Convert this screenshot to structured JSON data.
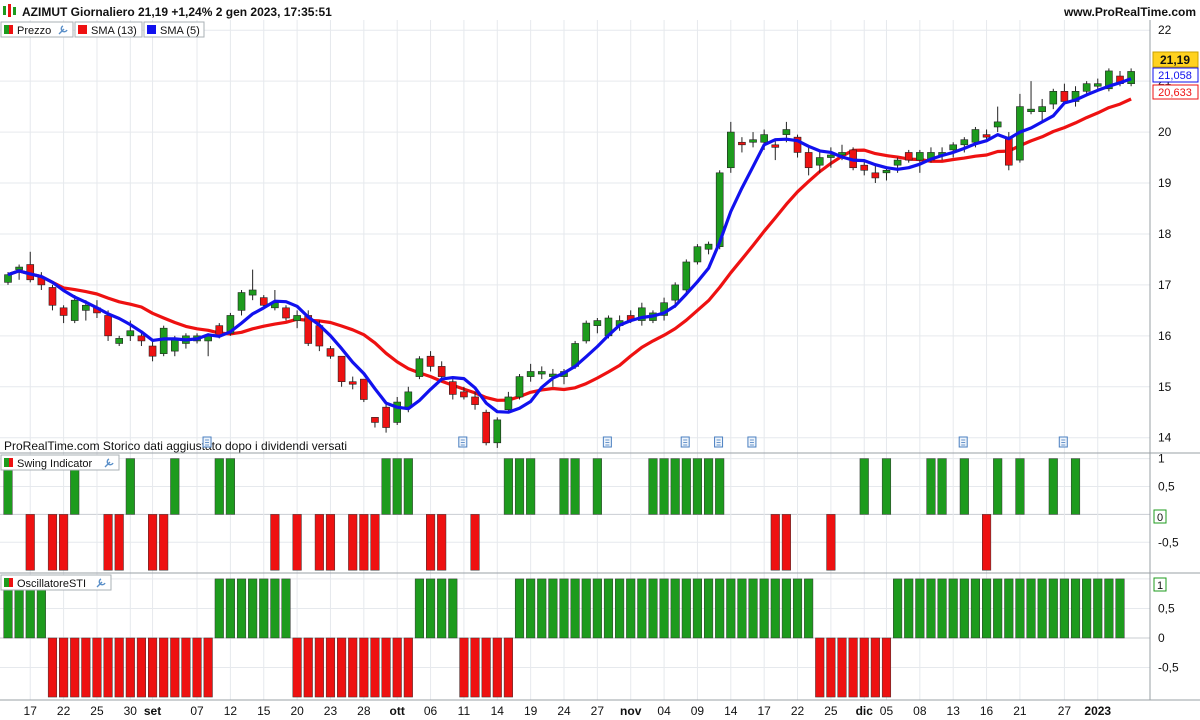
{
  "header": {
    "title": "AZIMUT Giornaliero 21,19 +1,24% 2 gen 2023, 17:35:51",
    "site": "www.ProRealTime.com"
  },
  "legend_main": [
    {
      "label": "Prezzo",
      "color": "#1d9b1d"
    },
    {
      "label": "SMA (13)",
      "color": "#ee1111"
    },
    {
      "label": "SMA (5)",
      "color": "#1111ee"
    }
  ],
  "notice": "ProRealTime.com Storico dati aggiustato dopo i dividendi versati",
  "panel2_title": "Swing Indicator",
  "panel3_title": "OscillatoreSTI",
  "colors": {
    "up": "#1d9b1d",
    "down": "#ee1111",
    "sma13": "#ee1111",
    "sma5": "#1111ee",
    "last_bg": "#ffd21f"
  },
  "chart_data": [
    {
      "type": "candlestick",
      "title": "AZIMUT Giornaliero",
      "ylim": [
        13.7,
        22.2
      ],
      "y_ticks": [
        "14",
        "15",
        "16",
        "17",
        "18",
        "19",
        "20",
        "21",
        "22"
      ],
      "y_tick_values": [
        14,
        15,
        16,
        17,
        18,
        19,
        20,
        21,
        22
      ],
      "x_tick_labels": [
        "17",
        "22",
        "25",
        "30",
        "set",
        "07",
        "12",
        "15",
        "20",
        "23",
        "28",
        "ott",
        "06",
        "11",
        "14",
        "19",
        "24",
        "27",
        "nov",
        "04",
        "09",
        "14",
        "17",
        "22",
        "25",
        "dic",
        "05",
        "08",
        "13",
        "16",
        "21",
        "27",
        "2023"
      ],
      "x_tick_index": [
        2,
        5,
        8,
        11,
        13,
        17,
        20,
        23,
        26,
        29,
        32,
        35,
        38,
        41,
        44,
        47,
        50,
        53,
        56,
        59,
        62,
        65,
        68,
        71,
        74,
        77,
        79,
        82,
        85,
        88,
        91,
        95,
        98
      ],
      "last_values": {
        "price": "21,19",
        "sma5": "21,058",
        "sma13": "20,633"
      },
      "candles": [
        [
          17.05,
          17.25,
          17.0,
          17.2
        ],
        [
          17.3,
          17.4,
          17.1,
          17.35
        ],
        [
          17.4,
          17.65,
          17.05,
          17.1
        ],
        [
          17.15,
          17.25,
          16.9,
          17.0
        ],
        [
          16.95,
          17.0,
          16.5,
          16.6
        ],
        [
          16.55,
          16.6,
          16.25,
          16.4
        ],
        [
          16.3,
          16.8,
          16.25,
          16.7
        ],
        [
          16.5,
          16.7,
          16.3,
          16.6
        ],
        [
          16.55,
          16.7,
          16.35,
          16.45
        ],
        [
          16.4,
          16.5,
          15.9,
          16.0
        ],
        [
          15.85,
          16.0,
          15.8,
          15.95
        ],
        [
          16.0,
          16.3,
          15.9,
          16.1
        ],
        [
          16.0,
          16.1,
          15.8,
          15.9
        ],
        [
          15.8,
          15.9,
          15.5,
          15.6
        ],
        [
          15.65,
          16.2,
          15.6,
          16.15
        ],
        [
          15.7,
          16.0,
          15.6,
          15.95
        ],
        [
          15.85,
          16.05,
          15.75,
          16.0
        ],
        [
          15.9,
          16.05,
          15.85,
          16.0
        ],
        [
          15.9,
          16.05,
          15.6,
          16.0
        ],
        [
          16.2,
          16.25,
          15.95,
          16.0
        ],
        [
          16.05,
          16.45,
          16.0,
          16.4
        ],
        [
          16.5,
          16.9,
          16.4,
          16.85
        ],
        [
          16.8,
          17.3,
          16.7,
          16.9
        ],
        [
          16.75,
          16.8,
          16.55,
          16.6
        ],
        [
          16.55,
          16.9,
          16.5,
          16.65
        ],
        [
          16.55,
          16.6,
          16.3,
          16.35
        ],
        [
          16.3,
          16.5,
          16.15,
          16.4
        ],
        [
          16.4,
          16.5,
          15.8,
          15.85
        ],
        [
          16.2,
          16.3,
          15.7,
          15.8
        ],
        [
          15.75,
          15.8,
          15.55,
          15.6
        ],
        [
          15.6,
          15.6,
          15.0,
          15.1
        ],
        [
          15.1,
          15.2,
          14.95,
          15.05
        ],
        [
          15.15,
          15.15,
          14.7,
          14.75
        ],
        [
          14.4,
          14.4,
          14.2,
          14.3
        ],
        [
          14.6,
          14.65,
          14.1,
          14.2
        ],
        [
          14.3,
          14.8,
          14.25,
          14.7
        ],
        [
          14.6,
          15.0,
          14.5,
          14.9
        ],
        [
          15.2,
          15.6,
          15.15,
          15.55
        ],
        [
          15.6,
          15.7,
          15.3,
          15.4
        ],
        [
          15.4,
          15.5,
          15.1,
          15.2
        ],
        [
          15.1,
          15.2,
          14.75,
          14.85
        ],
        [
          14.9,
          15.0,
          14.75,
          14.8
        ],
        [
          14.8,
          14.9,
          14.55,
          14.65
        ],
        [
          14.5,
          14.55,
          13.85,
          13.9
        ],
        [
          13.9,
          14.4,
          13.8,
          14.35
        ],
        [
          14.55,
          14.9,
          14.5,
          14.8
        ],
        [
          14.8,
          15.25,
          14.75,
          15.2
        ],
        [
          15.2,
          15.45,
          15.1,
          15.3
        ],
        [
          15.25,
          15.4,
          15.15,
          15.3
        ],
        [
          15.2,
          15.35,
          15.0,
          15.25
        ],
        [
          15.2,
          15.35,
          15.05,
          15.3
        ],
        [
          15.4,
          15.9,
          15.35,
          15.85
        ],
        [
          15.9,
          16.3,
          15.85,
          16.25
        ],
        [
          16.2,
          16.35,
          16.05,
          16.3
        ],
        [
          16.0,
          16.4,
          15.95,
          16.35
        ],
        [
          16.2,
          16.4,
          16.1,
          16.3
        ],
        [
          16.4,
          16.5,
          16.25,
          16.3
        ],
        [
          16.3,
          16.65,
          16.2,
          16.55
        ],
        [
          16.3,
          16.5,
          16.25,
          16.45
        ],
        [
          16.4,
          16.75,
          16.3,
          16.65
        ],
        [
          16.7,
          17.05,
          16.55,
          17.0
        ],
        [
          16.9,
          17.5,
          16.85,
          17.45
        ],
        [
          17.45,
          17.8,
          17.4,
          17.75
        ],
        [
          17.7,
          17.85,
          17.6,
          17.8
        ],
        [
          17.75,
          19.25,
          17.7,
          19.2
        ],
        [
          19.3,
          20.2,
          19.2,
          20.0
        ],
        [
          19.8,
          19.9,
          19.6,
          19.75
        ],
        [
          19.8,
          20.0,
          19.7,
          19.85
        ],
        [
          19.8,
          20.05,
          19.65,
          19.95
        ],
        [
          19.75,
          19.85,
          19.45,
          19.7
        ],
        [
          19.95,
          20.2,
          19.8,
          20.05
        ],
        [
          19.9,
          19.95,
          19.5,
          19.6
        ],
        [
          19.6,
          19.7,
          19.15,
          19.3
        ],
        [
          19.35,
          19.6,
          19.2,
          19.5
        ],
        [
          19.5,
          19.7,
          19.3,
          19.55
        ],
        [
          19.55,
          19.75,
          19.45,
          19.6
        ],
        [
          19.65,
          19.7,
          19.25,
          19.3
        ],
        [
          19.35,
          19.45,
          19.15,
          19.25
        ],
        [
          19.2,
          19.35,
          19.0,
          19.1
        ],
        [
          19.2,
          19.3,
          19.05,
          19.25
        ],
        [
          19.35,
          19.5,
          19.2,
          19.45
        ],
        [
          19.6,
          19.65,
          19.4,
          19.45
        ],
        [
          19.45,
          19.65,
          19.2,
          19.6
        ],
        [
          19.45,
          19.7,
          19.4,
          19.6
        ],
        [
          19.55,
          19.7,
          19.45,
          19.6
        ],
        [
          19.65,
          19.8,
          19.5,
          19.75
        ],
        [
          19.75,
          19.9,
          19.6,
          19.85
        ],
        [
          19.8,
          20.1,
          19.7,
          20.05
        ],
        [
          19.95,
          20.05,
          19.8,
          19.9
        ],
        [
          20.1,
          20.5,
          20.0,
          20.2
        ],
        [
          19.9,
          20.0,
          19.25,
          19.35
        ],
        [
          19.45,
          20.75,
          19.4,
          20.5
        ],
        [
          20.4,
          21.0,
          20.35,
          20.45
        ],
        [
          20.4,
          20.65,
          20.2,
          20.5
        ],
        [
          20.55,
          20.85,
          20.45,
          20.8
        ],
        [
          20.8,
          20.95,
          20.55,
          20.6
        ],
        [
          20.6,
          20.9,
          20.5,
          20.8
        ],
        [
          20.8,
          21.0,
          20.7,
          20.95
        ],
        [
          20.9,
          21.05,
          20.8,
          20.95
        ],
        [
          20.85,
          21.25,
          20.8,
          21.2
        ],
        [
          21.1,
          21.2,
          20.9,
          20.95
        ],
        [
          20.95,
          21.25,
          20.9,
          21.19
        ]
      ]
    },
    {
      "type": "bar",
      "title": "Swing Indicator",
      "ylim": [
        -1.05,
        1.1
      ],
      "y_ticks": [
        "1",
        "0,5",
        "0",
        "-0,5"
      ],
      "y_tick_values": [
        1,
        0.5,
        0,
        -0.5
      ],
      "last_value": "0",
      "values": [
        1,
        0,
        -1,
        0,
        -1,
        -1,
        1,
        0,
        0,
        -1,
        -1,
        1,
        0,
        -1,
        -1,
        1,
        0,
        0,
        0,
        1,
        1,
        0,
        0,
        0,
        -1,
        0,
        -1,
        0,
        -1,
        -1,
        0,
        -1,
        -1,
        -1,
        1,
        1,
        1,
        0,
        -1,
        -1,
        0,
        0,
        -1,
        0,
        0,
        1,
        1,
        1,
        0,
        0,
        1,
        1,
        0,
        1,
        0,
        0,
        0,
        0,
        1,
        1,
        1,
        1,
        1,
        1,
        1,
        0,
        0,
        0,
        0,
        -1,
        -1,
        0,
        0,
        0,
        -1,
        0,
        0,
        1,
        0,
        1,
        0,
        0,
        0,
        1,
        1,
        0,
        1,
        0,
        -1,
        1,
        0,
        1,
        0,
        0,
        1,
        0,
        1,
        0,
        0,
        0,
        0
      ]
    },
    {
      "type": "bar",
      "title": "OscillatoreSTI",
      "ylim": [
        -1.05,
        1.1
      ],
      "y_ticks": [
        "1",
        "0,5",
        "0",
        "-0,5"
      ],
      "y_tick_values": [
        1,
        0.5,
        0,
        -0.5
      ],
      "last_value": "1",
      "values": [
        1,
        1,
        1,
        1,
        -1,
        -1,
        -1,
        -1,
        -1,
        -1,
        -1,
        -1,
        -1,
        -1,
        -1,
        -1,
        -1,
        -1,
        -1,
        1,
        1,
        1,
        1,
        1,
        1,
        1,
        -1,
        -1,
        -1,
        -1,
        -1,
        -1,
        -1,
        -1,
        -1,
        -1,
        -1,
        1,
        1,
        1,
        1,
        -1,
        -1,
        -1,
        -1,
        -1,
        1,
        1,
        1,
        1,
        1,
        1,
        1,
        1,
        1,
        1,
        1,
        1,
        1,
        1,
        1,
        1,
        1,
        1,
        1,
        1,
        1,
        1,
        1,
        1,
        1,
        1,
        1,
        -1,
        -1,
        -1,
        -1,
        -1,
        -1,
        -1,
        1,
        1,
        1,
        1,
        1,
        1,
        1,
        1,
        1,
        1,
        1,
        1,
        1,
        1,
        1,
        1,
        1,
        1,
        1,
        1,
        1
      ]
    }
  ]
}
